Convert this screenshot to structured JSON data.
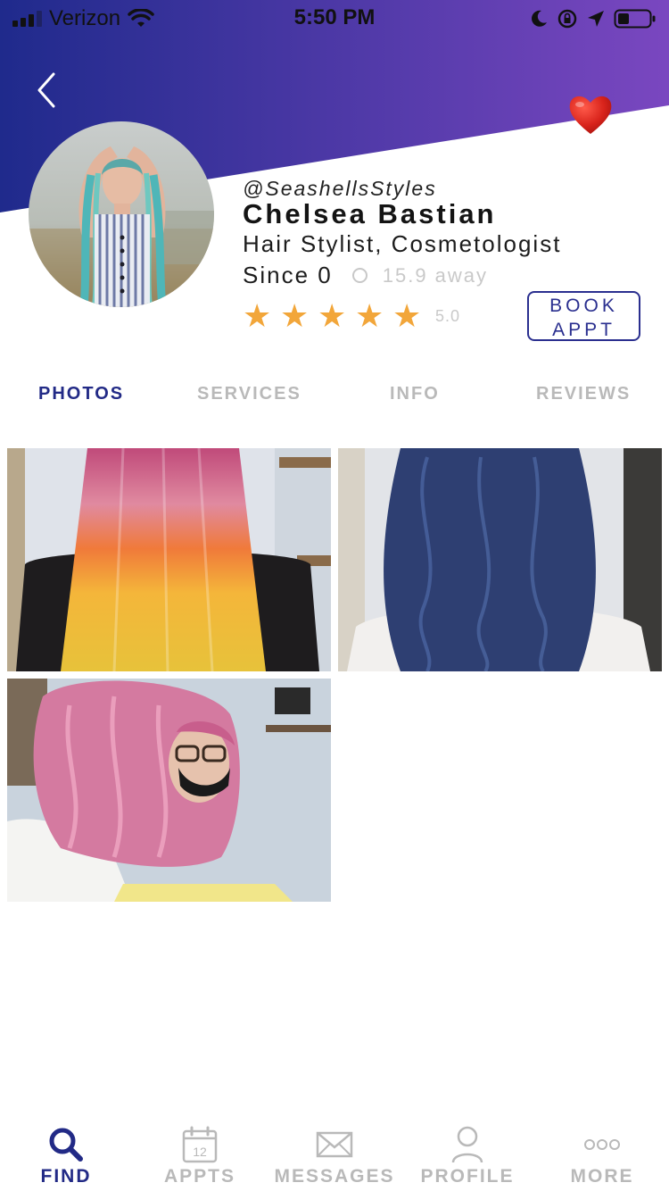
{
  "status_bar": {
    "carrier": "Verizon",
    "time": "5:50 PM"
  },
  "profile": {
    "handle": "@SeashellsStyles",
    "name": "Chelsea Bastian",
    "role": "Hair Stylist, Cosmetologist",
    "since": "Since 0",
    "distance": "15.9 away",
    "rating": 5,
    "rating_label": "5.0",
    "book_label_line1": "BOOK",
    "book_label_line2": "APPT"
  },
  "tabs": [
    {
      "label": "PHOTOS",
      "active": true
    },
    {
      "label": "SERVICES",
      "active": false
    },
    {
      "label": "INFO",
      "active": false
    },
    {
      "label": "REVIEWS",
      "active": false
    }
  ],
  "photos": [
    {
      "subject": "sunset-rainbow-hair"
    },
    {
      "subject": "blue-wavy-hair"
    },
    {
      "subject": "pink-wavy-hair"
    }
  ],
  "bottom_nav": [
    {
      "label": "FIND",
      "icon": "search-icon",
      "active": true
    },
    {
      "label": "APPTS",
      "icon": "calendar-icon",
      "calendar_day": "12",
      "active": false
    },
    {
      "label": "MESSAGES",
      "icon": "envelope-icon",
      "active": false
    },
    {
      "label": "PROFILE",
      "icon": "person-icon",
      "active": false
    },
    {
      "label": "MORE",
      "icon": "more-dots-icon",
      "active": false
    }
  ],
  "colors": {
    "brand": "#222a86",
    "gradient_start": "#1f2a8c",
    "gradient_end": "#7a47c0",
    "star": "#f2a63a",
    "inactive": "#b9b9b9"
  }
}
